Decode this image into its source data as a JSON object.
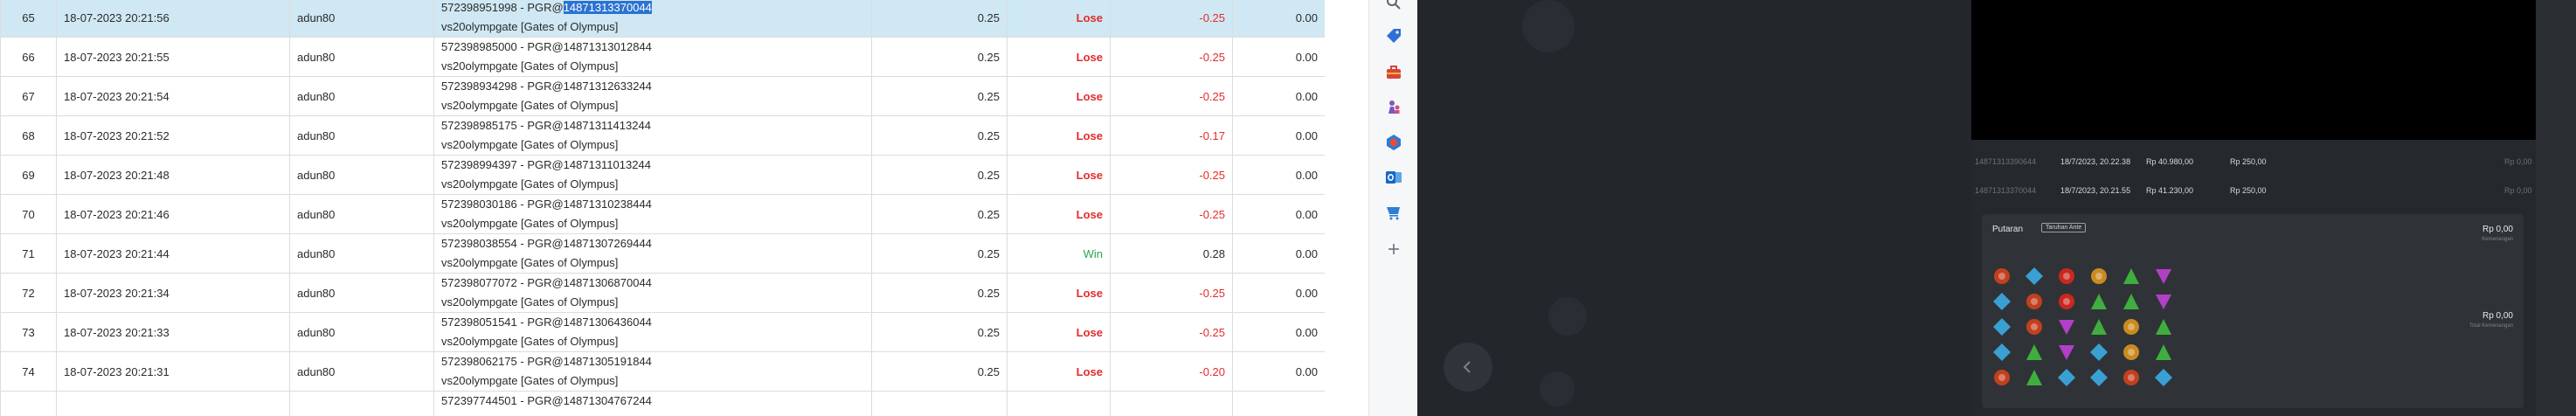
{
  "table": {
    "rows": [
      {
        "no": "65",
        "date": "18-07-2023 20:21:56",
        "user": "adun80",
        "bet_pre": "572398951998 - PGR@",
        "bet_hl": "14871313370044",
        "bet_line2": "vs20olympgate [Gates of Olympus]",
        "stake": "0.25",
        "result": "Lose",
        "win": "-0.25",
        "extra": "0.00",
        "selected": true
      },
      {
        "no": "66",
        "date": "18-07-2023 20:21:55",
        "user": "adun80",
        "bet_pre": "572398985000 - PGR@14871313012844",
        "bet_hl": "",
        "bet_line2": "vs20olympgate [Gates of Olympus]",
        "stake": "0.25",
        "result": "Lose",
        "win": "-0.25",
        "extra": "0.00"
      },
      {
        "no": "67",
        "date": "18-07-2023 20:21:54",
        "user": "adun80",
        "bet_pre": "572398934298 - PGR@14871312633244",
        "bet_hl": "",
        "bet_line2": "vs20olympgate [Gates of Olympus]",
        "stake": "0.25",
        "result": "Lose",
        "win": "-0.25",
        "extra": "0.00"
      },
      {
        "no": "68",
        "date": "18-07-2023 20:21:52",
        "user": "adun80",
        "bet_pre": "572398985175 - PGR@14871311413244",
        "bet_hl": "",
        "bet_line2": "vs20olympgate [Gates of Olympus]",
        "stake": "0.25",
        "result": "Lose",
        "win": "-0.17",
        "extra": "0.00"
      },
      {
        "no": "69",
        "date": "18-07-2023 20:21:48",
        "user": "adun80",
        "bet_pre": "572398994397 - PGR@14871311013244",
        "bet_hl": "",
        "bet_line2": "vs20olympgate [Gates of Olympus]",
        "stake": "0.25",
        "result": "Lose",
        "win": "-0.25",
        "extra": "0.00"
      },
      {
        "no": "70",
        "date": "18-07-2023 20:21:46",
        "user": "adun80",
        "bet_pre": "572398030186 - PGR@14871310238444",
        "bet_hl": "",
        "bet_line2": "vs20olympgate [Gates of Olympus]",
        "stake": "0.25",
        "result": "Lose",
        "win": "-0.25",
        "extra": "0.00"
      },
      {
        "no": "71",
        "date": "18-07-2023 20:21:44",
        "user": "adun80",
        "bet_pre": "572398038554 - PGR@14871307269444",
        "bet_hl": "",
        "bet_line2": "vs20olympgate [Gates of Olympus]",
        "stake": "0.25",
        "result": "Win",
        "win": "0.28",
        "extra": "0.00"
      },
      {
        "no": "72",
        "date": "18-07-2023 20:21:34",
        "user": "adun80",
        "bet_pre": "572398077072 - PGR@14871306870044",
        "bet_hl": "",
        "bet_line2": "vs20olympgate [Gates of Olympus]",
        "stake": "0.25",
        "result": "Lose",
        "win": "-0.25",
        "extra": "0.00"
      },
      {
        "no": "73",
        "date": "18-07-2023 20:21:33",
        "user": "adun80",
        "bet_pre": "572398051541 - PGR@14871306436044",
        "bet_hl": "",
        "bet_line2": "vs20olympgate [Gates of Olympus]",
        "stake": "0.25",
        "result": "Lose",
        "win": "-0.25",
        "extra": "0.00"
      },
      {
        "no": "74",
        "date": "18-07-2023 20:21:31",
        "user": "adun80",
        "bet_pre": "572398062175 - PGR@14871305191844",
        "bet_hl": "",
        "bet_line2": "vs20olympgate [Gates of Olympus]",
        "stake": "0.25",
        "result": "Lose",
        "win": "-0.20",
        "extra": "0.00"
      },
      {
        "no": "",
        "date": "",
        "user": "",
        "bet_pre": "572397744501 - PGR@14871304767244",
        "bet_hl": "",
        "bet_line2": "",
        "stake": "",
        "result": "",
        "win": "",
        "extra": ""
      }
    ]
  },
  "toolbar": {
    "icons": [
      "search-icon",
      "tag-icon",
      "toolbox-icon",
      "chess-icon",
      "office-icon",
      "outlook-icon",
      "shopping-cart-icon",
      "plus-icon"
    ],
    "colors": [
      "#5b6470",
      "#2f6fd6",
      "#d9443a",
      "#7a57c7",
      "#2d7bd4",
      "#1469c7",
      "#2c7fd3",
      "#6b7280"
    ]
  },
  "game": {
    "history": [
      {
        "id": "14871313390644",
        "date": "18/7/2023, 20.22.38",
        "balance": "Rp 40.980,00",
        "bet": "Rp 250,00",
        "win": "Rp 0,00"
      },
      {
        "id": "14871313370044",
        "date": "18/7/2023, 20.21.55",
        "balance": "Rp 41.230,00",
        "bet": "Rp 250,00",
        "win": "Rp 0,00"
      }
    ],
    "spin": {
      "title": "Putaran",
      "chip": "Taruhan Ante",
      "amount_top": "Rp 0,00",
      "sub_top": "Kemenangan",
      "amount_mid": "Rp 0,00",
      "sub_mid": "Total Kemenangan"
    },
    "symbol_colors": [
      "#c2401f",
      "#3aa0d4",
      "#c9281f",
      "#c98b1f",
      "#3fae3f",
      "#b23fc8"
    ]
  }
}
